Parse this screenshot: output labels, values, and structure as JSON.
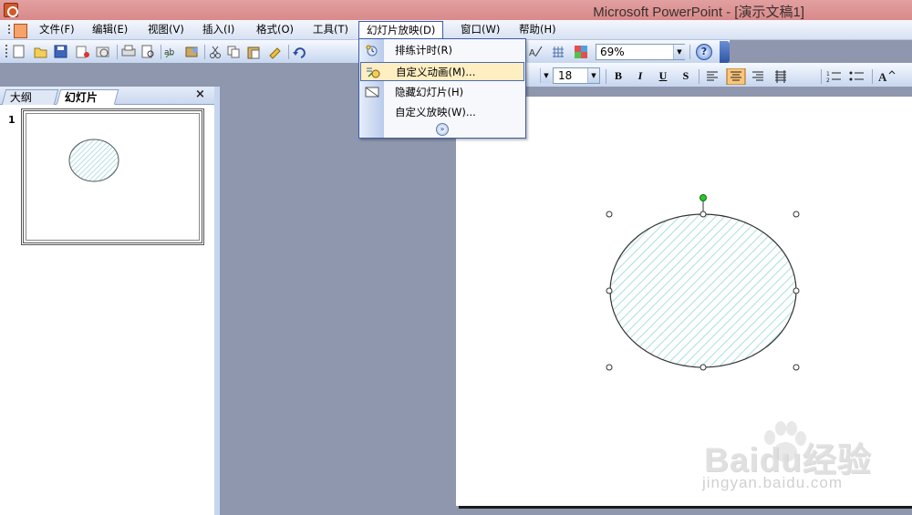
{
  "window": {
    "title": "Microsoft PowerPoint - [演示文稿1]"
  },
  "menubar": {
    "items": [
      {
        "label": "文件(F)"
      },
      {
        "label": "编辑(E)"
      },
      {
        "label": "视图(V)"
      },
      {
        "label": "插入(I)"
      },
      {
        "label": "格式(O)"
      },
      {
        "label": "工具(T)"
      },
      {
        "label": "幻灯片放映(D)"
      },
      {
        "label": "窗口(W)"
      },
      {
        "label": "帮助(H)"
      }
    ],
    "active_item": "幻灯片放映(D)"
  },
  "slideshow_menu": {
    "items": [
      {
        "label": "排练计时(R)",
        "icon": "timer-icon"
      },
      {
        "label": "自定义动画(M)...",
        "icon": "custom-animation-icon",
        "highlighted": true
      },
      {
        "label": "隐藏幻灯片(H)",
        "icon": "hide-slide-icon"
      },
      {
        "label": "自定义放映(W)...",
        "icon": ""
      }
    ],
    "expand_icon": "expand-arrows-icon"
  },
  "toolbar": {
    "zoom_value": "69%",
    "font_size": "18",
    "bold_label": "B",
    "italic_label": "I",
    "underline_label": "U",
    "shadow_label": "S",
    "font_grow_label": "A"
  },
  "left_pane": {
    "tabs": [
      {
        "label": "大纲"
      },
      {
        "label": "幻灯片",
        "active": true
      }
    ],
    "close_label": "×",
    "slide_number": "1"
  },
  "slide": {
    "shape": "hatched-circle",
    "selected": true
  },
  "watermark": {
    "brand": "Baidu经验",
    "url": "jingyan.baidu.com"
  },
  "colors": {
    "titlebar": "#d98a8a",
    "menu_highlight": "#ffeec2",
    "hatch": "#8fd3d6",
    "workspace": "#8e97ad"
  }
}
